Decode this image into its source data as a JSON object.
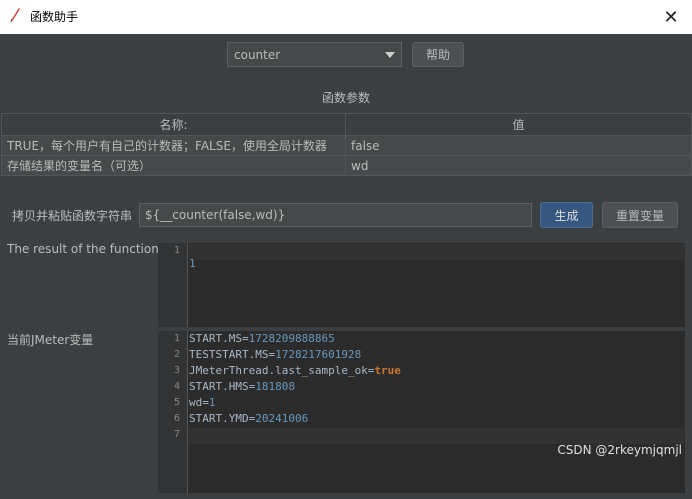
{
  "window": {
    "title": "函数助手",
    "close_glyph": "✕"
  },
  "function_select": {
    "value": "counter"
  },
  "help_button": "帮助",
  "params": {
    "title": "函数参数",
    "headers": [
      "名称:",
      "值"
    ],
    "rows": [
      {
        "name": "TRUE，每个用户有自己的计数器；FALSE，使用全局计数器",
        "value": "false"
      },
      {
        "name": "存储结果的变量名（可选）",
        "value": "wd"
      }
    ]
  },
  "copy": {
    "label": "拷贝并粘贴函数字符串",
    "value": "${__counter(false,wd)}"
  },
  "buttons": {
    "generate": "生成",
    "reset": "重置变量"
  },
  "result": {
    "label": "The result of the function is",
    "lines": [
      {
        "n": "1",
        "text": "1"
      }
    ]
  },
  "vars": {
    "label": "当前JMeter变量",
    "lines": [
      {
        "n": "1",
        "key": "START.MS=",
        "val": "1728209888865"
      },
      {
        "n": "2",
        "key": "TESTSTART.MS=",
        "val": "1728217601928"
      },
      {
        "n": "3",
        "key": "JMeterThread.last_sample_ok=",
        "val": "true"
      },
      {
        "n": "4",
        "key": "START.HMS=",
        "val": "181808"
      },
      {
        "n": "5",
        "key": "wd=",
        "val": "1"
      },
      {
        "n": "6",
        "key": "START.YMD=",
        "val": "20241006"
      },
      {
        "n": "7",
        "key": "",
        "val": ""
      }
    ]
  },
  "watermark": "CSDN @2rkeymjqmjl",
  "colors": {
    "background": "#3c3f41",
    "editor_bg": "#2b2b2b",
    "number": "#6897bb",
    "keyword": "#cc7832",
    "primary_button": "#365880"
  }
}
